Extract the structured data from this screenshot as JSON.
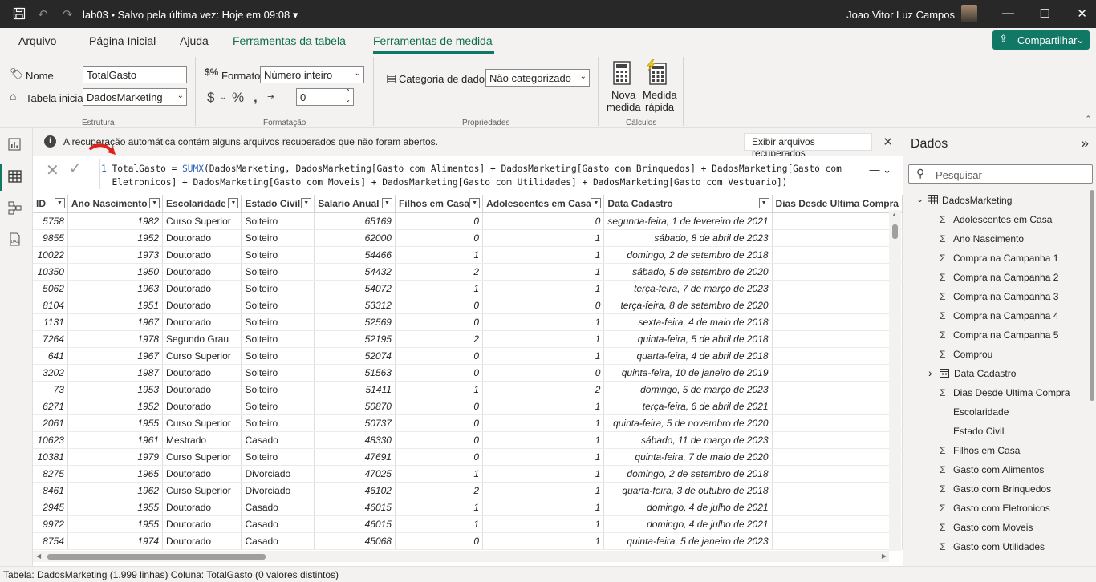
{
  "titlebar": {
    "file": "lab03",
    "save_status": "•  Salvo pela última vez: Hoje em 09:08",
    "user": "Joao Vitor Luz Campos"
  },
  "tabs": [
    "Arquivo",
    "Página Inicial",
    "Ajuda",
    "Ferramentas da tabela",
    "Ferramentas de medida"
  ],
  "share_label": "Compartilhar",
  "ribbon": {
    "nome_label": "Nome",
    "nome_value": "TotalGasto",
    "tabela_label": "Tabela inicial",
    "tabela_value": "DadosMarketing",
    "estrutura": "Estrutura",
    "formato_label": "Formato",
    "formato_value": "Número inteiro",
    "decimal_value": "0",
    "formatacao": "Formatação",
    "categoria_label": "Categoria de dados",
    "categoria_value": "Não categorizado",
    "propriedades": "Propriedades",
    "nova_medida": [
      "Nova",
      "medida"
    ],
    "medida_rapida": [
      "Medida",
      "rápida"
    ],
    "calculos": "Cálculos"
  },
  "infobar": {
    "text": "A recuperação automática contém alguns arquivos recuperados que não foram abertos.",
    "button": "Exibir arquivos recuperados"
  },
  "formula": {
    "line_no": "1",
    "line1_name": "TotalGasto = ",
    "line1_fn": "SUMX",
    "line1_rest": "(DadosMarketing, DadosMarketing[Gasto com Alimentos] + DadosMarketing[Gasto com Brinquedos] + DadosMarketing[Gasto com",
    "line2": "Eletronicos] + DadosMarketing[Gasto com Moveis] + DadosMarketing[Gasto com Utilidades] + DadosMarketing[Gasto com Vestuario])"
  },
  "table": {
    "columns": [
      "ID",
      "Ano Nascimento",
      "Escolaridade",
      "Estado Civil",
      "Salario Anual",
      "Filhos em Casa",
      "Adolescentes em Casa",
      "Data Cadastro",
      "Dias Desde Ultima Compra"
    ],
    "rows": [
      [
        "5758",
        "1982",
        "Curso Superior",
        "Solteiro",
        "65169",
        "0",
        "0",
        "segunda-feira, 1 de fevereiro de 2021"
      ],
      [
        "9855",
        "1952",
        "Doutorado",
        "Solteiro",
        "62000",
        "0",
        "1",
        "sábado, 8 de abril de 2023"
      ],
      [
        "10022",
        "1973",
        "Doutorado",
        "Solteiro",
        "54466",
        "1",
        "1",
        "domingo, 2 de setembro de 2018"
      ],
      [
        "10350",
        "1950",
        "Doutorado",
        "Solteiro",
        "54432",
        "2",
        "1",
        "sábado, 5 de setembro de 2020"
      ],
      [
        "5062",
        "1963",
        "Doutorado",
        "Solteiro",
        "54072",
        "1",
        "1",
        "terça-feira, 7 de março de 2023"
      ],
      [
        "8104",
        "1951",
        "Doutorado",
        "Solteiro",
        "53312",
        "0",
        "0",
        "terça-feira, 8 de setembro de 2020"
      ],
      [
        "1131",
        "1967",
        "Doutorado",
        "Solteiro",
        "52569",
        "0",
        "1",
        "sexta-feira, 4 de maio de 2018"
      ],
      [
        "7264",
        "1978",
        "Segundo Grau",
        "Solteiro",
        "52195",
        "2",
        "1",
        "quinta-feira, 5 de abril de 2018"
      ],
      [
        "641",
        "1967",
        "Curso Superior",
        "Solteiro",
        "52074",
        "0",
        "1",
        "quarta-feira, 4 de abril de 2018"
      ],
      [
        "3202",
        "1987",
        "Doutorado",
        "Solteiro",
        "51563",
        "0",
        "0",
        "quinta-feira, 10 de janeiro de 2019"
      ],
      [
        "73",
        "1953",
        "Doutorado",
        "Solteiro",
        "51411",
        "1",
        "2",
        "domingo, 5 de março de 2023"
      ],
      [
        "6271",
        "1952",
        "Doutorado",
        "Solteiro",
        "50870",
        "0",
        "1",
        "terça-feira, 6 de abril de 2021"
      ],
      [
        "2061",
        "1955",
        "Curso Superior",
        "Solteiro",
        "50737",
        "0",
        "1",
        "quinta-feira, 5 de novembro de 2020"
      ],
      [
        "10623",
        "1961",
        "Mestrado",
        "Casado",
        "48330",
        "0",
        "1",
        "sábado, 11 de março de 2023"
      ],
      [
        "10381",
        "1979",
        "Curso Superior",
        "Solteiro",
        "47691",
        "0",
        "1",
        "quinta-feira, 7 de maio de 2020"
      ],
      [
        "8275",
        "1965",
        "Doutorado",
        "Divorciado",
        "47025",
        "1",
        "1",
        "domingo, 2 de setembro de 2018"
      ],
      [
        "8461",
        "1962",
        "Curso Superior",
        "Divorciado",
        "46102",
        "2",
        "1",
        "quarta-feira, 3 de outubro de 2018"
      ],
      [
        "2945",
        "1955",
        "Doutorado",
        "Casado",
        "46015",
        "1",
        "1",
        "domingo, 4 de julho de 2021"
      ],
      [
        "9972",
        "1955",
        "Doutorado",
        "Casado",
        "46015",
        "1",
        "1",
        "domingo, 4 de julho de 2021"
      ],
      [
        "8754",
        "1974",
        "Doutorado",
        "Casado",
        "45068",
        "0",
        "1",
        "quinta-feira, 5 de janeiro de 2023"
      ]
    ]
  },
  "data_pane": {
    "title": "Dados",
    "search_placeholder": "Pesquisar",
    "table_name": "DadosMarketing",
    "fields": [
      {
        "name": "Adolescentes em Casa",
        "icon": "sigma"
      },
      {
        "name": "Ano Nascimento",
        "icon": "sigma"
      },
      {
        "name": "Compra na Campanha 1",
        "icon": "sigma"
      },
      {
        "name": "Compra na Campanha 2",
        "icon": "sigma"
      },
      {
        "name": "Compra na Campanha 3",
        "icon": "sigma"
      },
      {
        "name": "Compra na Campanha 4",
        "icon": "sigma"
      },
      {
        "name": "Compra na Campanha 5",
        "icon": "sigma"
      },
      {
        "name": "Comprou",
        "icon": "sigma"
      },
      {
        "name": "Data Cadastro",
        "icon": "calendar"
      },
      {
        "name": "Dias Desde Ultima Compra",
        "icon": "sigma"
      },
      {
        "name": "Escolaridade",
        "icon": "none"
      },
      {
        "name": "Estado Civil",
        "icon": "none"
      },
      {
        "name": "Filhos em Casa",
        "icon": "sigma"
      },
      {
        "name": "Gasto com Alimentos",
        "icon": "sigma"
      },
      {
        "name": "Gasto com Brinquedos",
        "icon": "sigma"
      },
      {
        "name": "Gasto com Eletronicos",
        "icon": "sigma"
      },
      {
        "name": "Gasto com Moveis",
        "icon": "sigma"
      },
      {
        "name": "Gasto com Utilidades",
        "icon": "sigma"
      }
    ]
  },
  "status": "Tabela: DadosMarketing (1.999 linhas) Coluna: TotalGasto (0 valores distintos)",
  "colors": {
    "accent": "#117865",
    "titlebar": "#282828",
    "arrow": "#e0211b"
  }
}
